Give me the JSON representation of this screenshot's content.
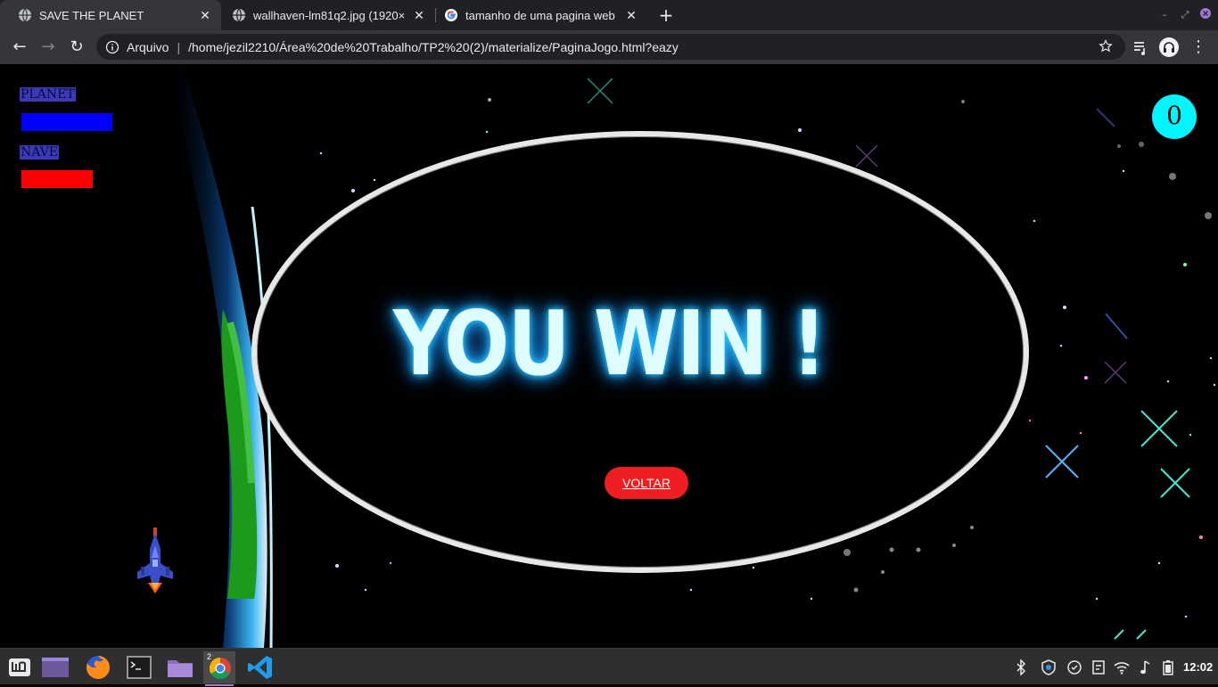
{
  "browser": {
    "tabs": [
      {
        "title": "SAVE THE PLANET",
        "icon": "globe-icon",
        "active": true
      },
      {
        "title": "wallhaven-lm81q2.jpg (1920×",
        "icon": "globe-icon",
        "active": false
      },
      {
        "title": "tamanho de uma pagina web",
        "icon": "google-icon",
        "active": false
      }
    ],
    "new_tab_label": "+",
    "omnibox": {
      "origin_label": "Arquivo",
      "url": "/home/jezil2210/Área%20de%20Trabalho/TP2%20(2)/materialize/PaginaJogo.html?eazy"
    }
  },
  "game": {
    "hud": {
      "planet_label": "PLANET",
      "planet_health": 1.0,
      "ship_label": "NAVE",
      "ship_health": 0.78,
      "planet_color": "#0000ff",
      "ship_color": "#ff0000"
    },
    "score": "0",
    "win_message": "YOU WIN !",
    "back_button_label": "VOLTAR",
    "accent": "#00f5ff"
  },
  "taskbar": {
    "apps": [
      {
        "name": "mint-menu-icon"
      },
      {
        "name": "show-desktop-icon"
      },
      {
        "name": "firefox-icon"
      },
      {
        "name": "terminal-icon"
      },
      {
        "name": "files-icon"
      },
      {
        "name": "chrome-icon",
        "badge": "2"
      },
      {
        "name": "vscode-icon"
      }
    ],
    "clock": "12:02"
  }
}
